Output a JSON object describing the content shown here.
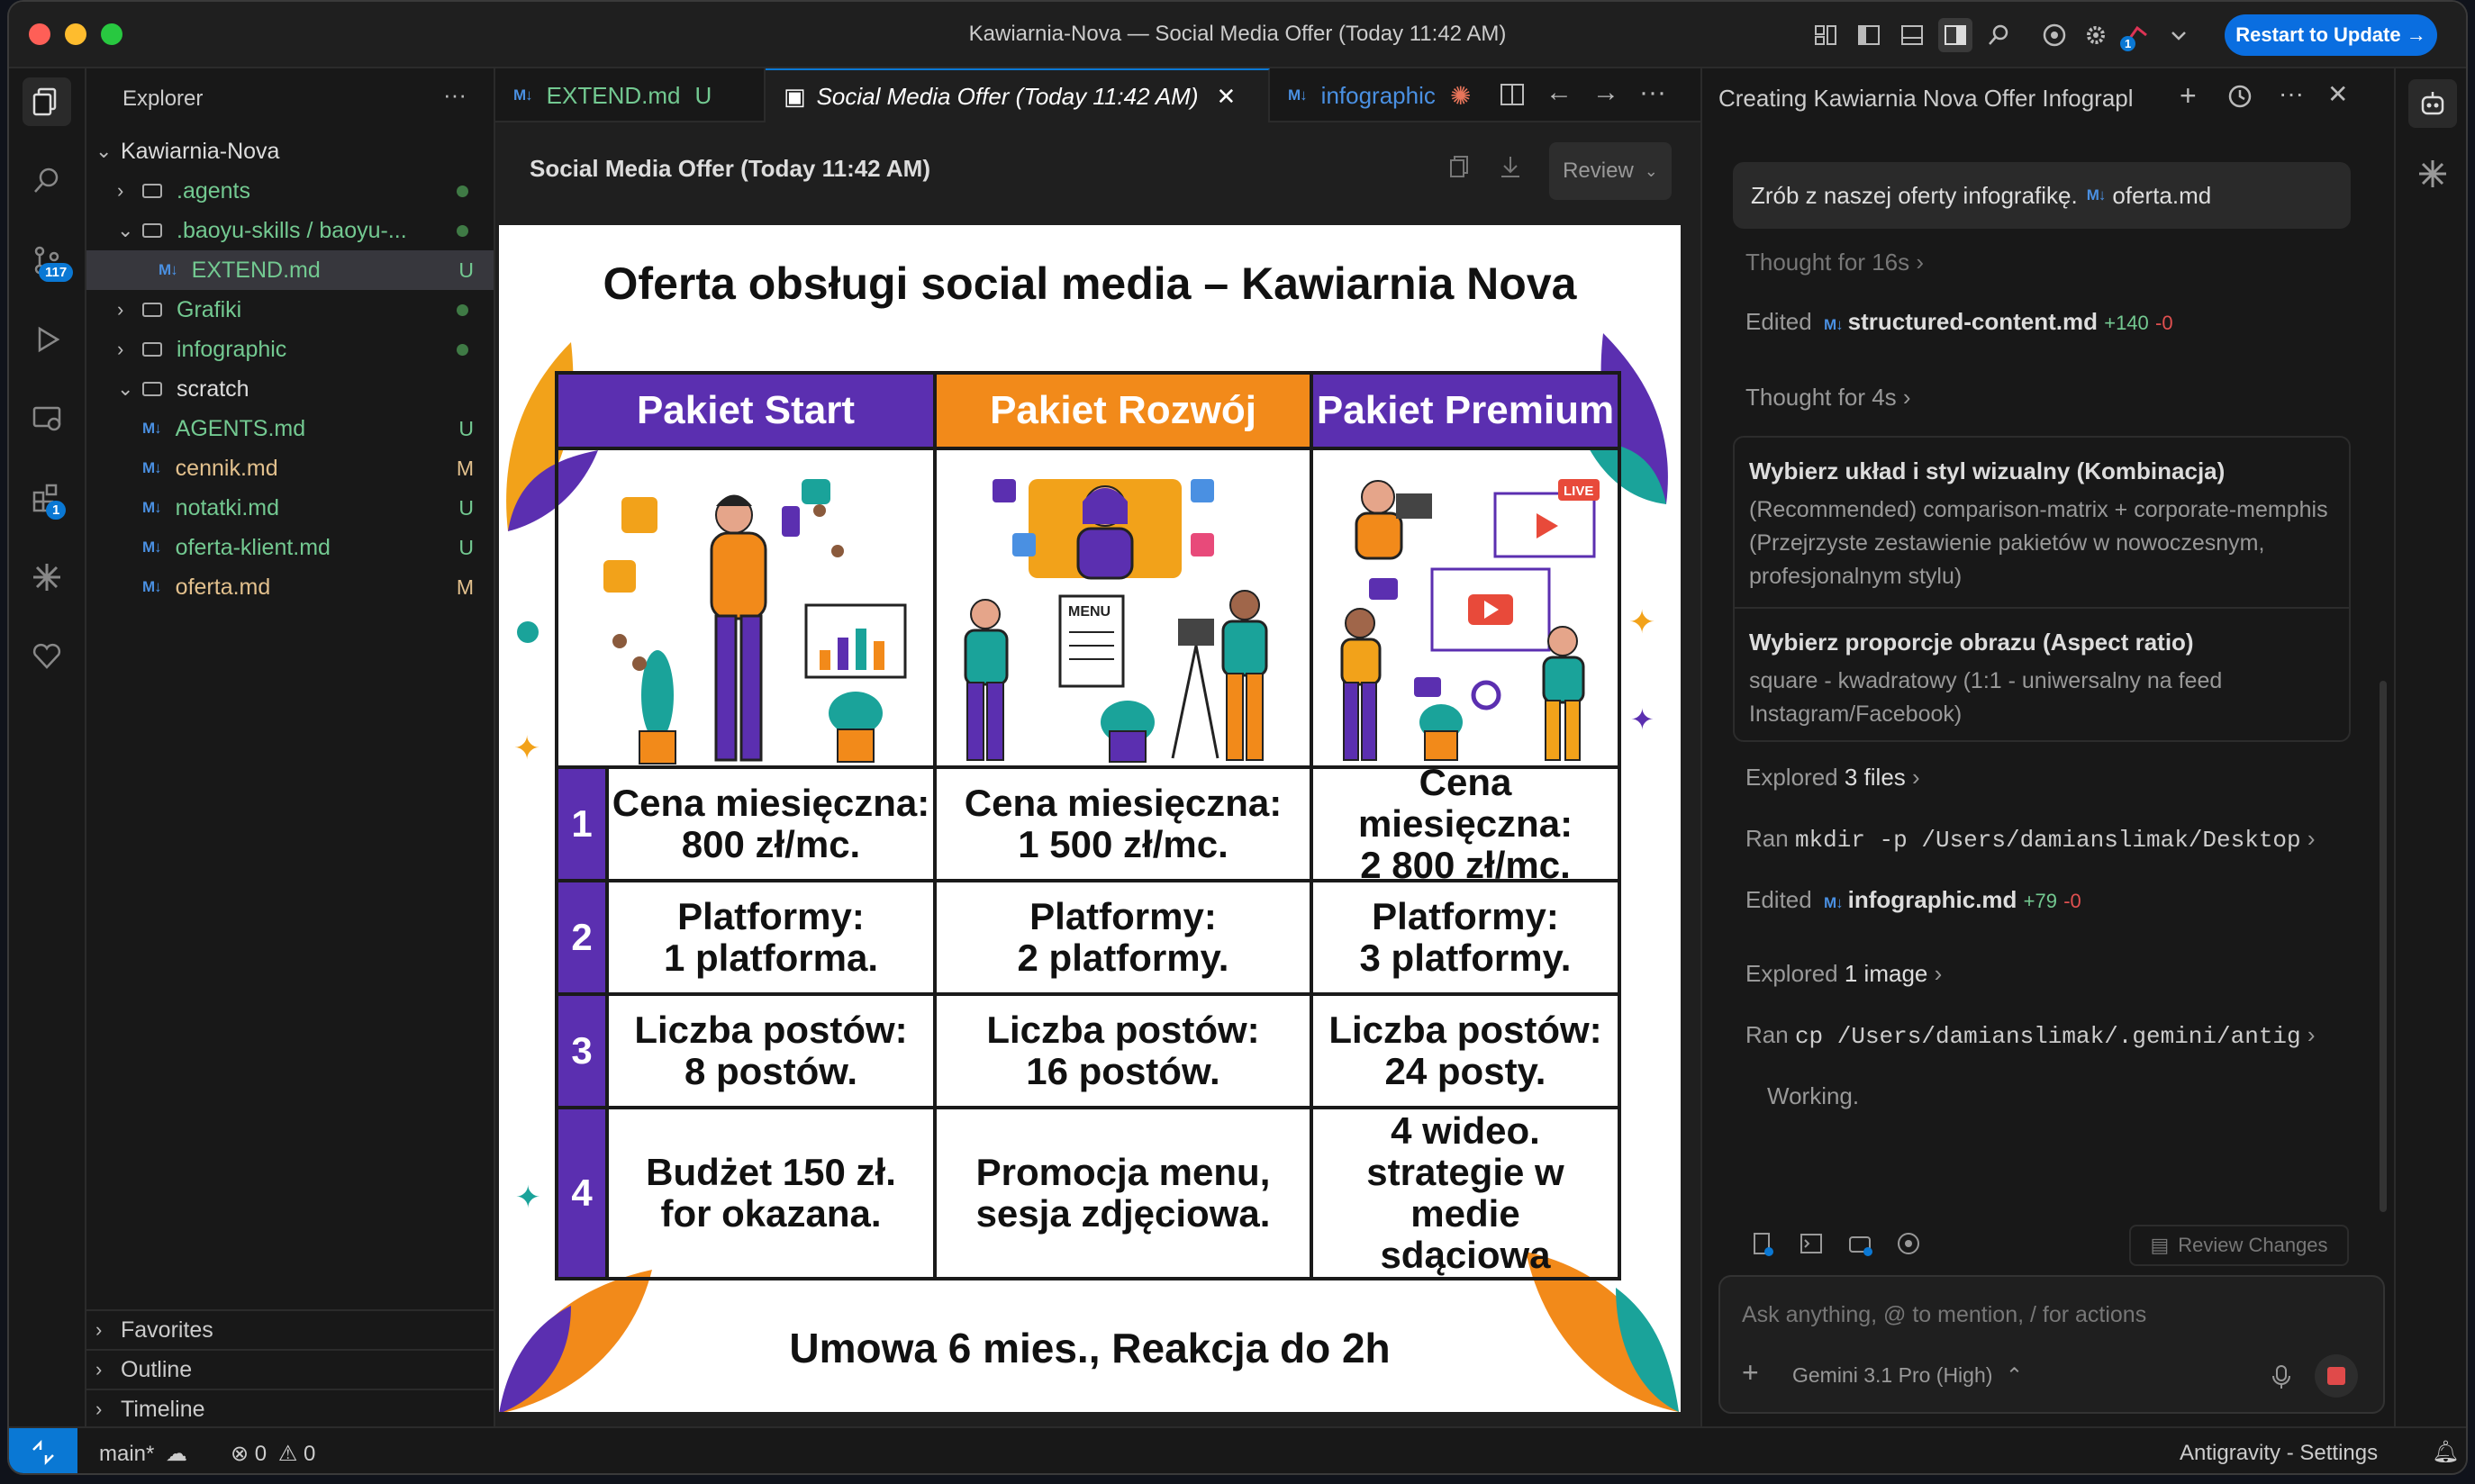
{
  "window": {
    "title": "Kawiarnia-Nova — Social Media Offer (Today 11:42 AM)",
    "update_button": "Restart to Update →"
  },
  "activity_bar": {
    "scm_badge": "117",
    "ext_badge": "1"
  },
  "explorer": {
    "header": "Explorer",
    "more": "···",
    "root": "Kawiarnia-Nova",
    "items": [
      {
        "label": ".agents",
        "status": ""
      },
      {
        "label": ".baoyu-skills / baoyu-...",
        "status": ""
      },
      {
        "label": "EXTEND.md",
        "status": "U"
      },
      {
        "label": "Grafiki",
        "status": ""
      },
      {
        "label": "infographic",
        "status": ""
      },
      {
        "label": "scratch",
        "status": ""
      },
      {
        "label": "AGENTS.md",
        "status": "U"
      },
      {
        "label": "cennik.md",
        "status": "M"
      },
      {
        "label": "notatki.md",
        "status": "U"
      },
      {
        "label": "oferta-klient.md",
        "status": "U"
      },
      {
        "label": "oferta.md",
        "status": "M"
      }
    ],
    "sections": [
      "Favorites",
      "Outline",
      "Timeline"
    ]
  },
  "tabs": [
    {
      "label": "EXTEND.md",
      "status": "U"
    },
    {
      "label": "Social Media Offer (Today 11:42 AM)"
    },
    {
      "label": "infographic"
    }
  ],
  "editor": {
    "heading": "Social Media Offer (Today 11:42 AM)",
    "review": "Review"
  },
  "infographic": {
    "title": "Oferta obsługi social media – Kawiarnia Nova",
    "packages": [
      {
        "name": "Pakiet Start",
        "color": "#5b2fb0"
      },
      {
        "name": "Pakiet Rozwój",
        "color": "#f28a1a"
      },
      {
        "name": "Pakiet Premium",
        "color": "#5b2fb0"
      }
    ],
    "rows": [
      {
        "num": "1",
        "cells": [
          [
            "Cena miesięczna:",
            "800 zł/mc."
          ],
          [
            "Cena miesięczna:",
            "1 500 zł/mc."
          ],
          [
            "Cena miesięczna:",
            "2 800 zł/mc."
          ]
        ]
      },
      {
        "num": "2",
        "cells": [
          [
            "Platformy:",
            "1 platforma."
          ],
          [
            "Platformy:",
            "2 platformy."
          ],
          [
            "Platformy:",
            "3 platformy."
          ]
        ]
      },
      {
        "num": "3",
        "cells": [
          [
            "Liczba postów:",
            "8 postów."
          ],
          [
            "Liczba postów:",
            "16 postów."
          ],
          [
            "Liczba postów:",
            "24 posty."
          ]
        ]
      },
      {
        "num": "4",
        "cells": [
          [
            "Budżet 150 zł.",
            "for okazana."
          ],
          [
            "Promocja menu,",
            "sesja zdjęciowa."
          ],
          [
            "4 wideo.",
            "strategie w medie",
            "sdąciowa"
          ]
        ]
      }
    ],
    "footer": "Umowa 6 mies., Reakcja do 2h",
    "illustration_labels": {
      "menu": "MENU",
      "live": "LIVE"
    }
  },
  "chat": {
    "title": "Creating Kawiarnia Nova Offer Infograpl",
    "user_msg": "Zrób z naszej oferty infografikę.",
    "user_file": "oferta.md",
    "thought1": "Thought for 16s",
    "edit1_prefix": "Edited",
    "edit1_file": "structured-content.md",
    "edit1_add": "+140",
    "edit1_del": "-0",
    "thought2": "Thought for 4s",
    "q1_title": "Wybierz układ i styl wizualny (Kombinacja)",
    "q1_answer": "(Recommended) comparison-matrix + corporate-memphis (Przejrzyste zestawienie pakietów w nowoczesnym, profesjonalnym stylu)",
    "q2_title": "Wybierz proporcje obrazu (Aspect ratio)",
    "q2_answer": "square - kwadratowy (1:1 - uniwersalny na feed Instagram/Facebook)",
    "explored1_prefix": "Explored",
    "explored1": "3 files",
    "ran1_prefix": "Ran",
    "ran1": "mkdir -p /Users/damianslimak/Desktop",
    "edit2_prefix": "Edited",
    "edit2_file": "infographic.md",
    "edit2_add": "+79",
    "edit2_del": "-0",
    "explored2_prefix": "Explored",
    "explored2": "1 image",
    "ran2_prefix": "Ran",
    "ran2": "cp /Users/damianslimak/.gemini/antig",
    "working": "Working.",
    "review_changes": "Review Changes",
    "input_placeholder": "Ask anything, @ to mention, / for actions",
    "model": "Gemini 3.1 Pro (High)"
  },
  "statusbar": {
    "branch": "main*",
    "errors": "0",
    "warnings": "0",
    "right": "Antigravity - Settings"
  },
  "colors": {
    "accent": "#0a78d4",
    "purple": "#5b2fb0",
    "orange": "#f28a1a",
    "added": "#73c991",
    "modified": "#e2c08d"
  }
}
